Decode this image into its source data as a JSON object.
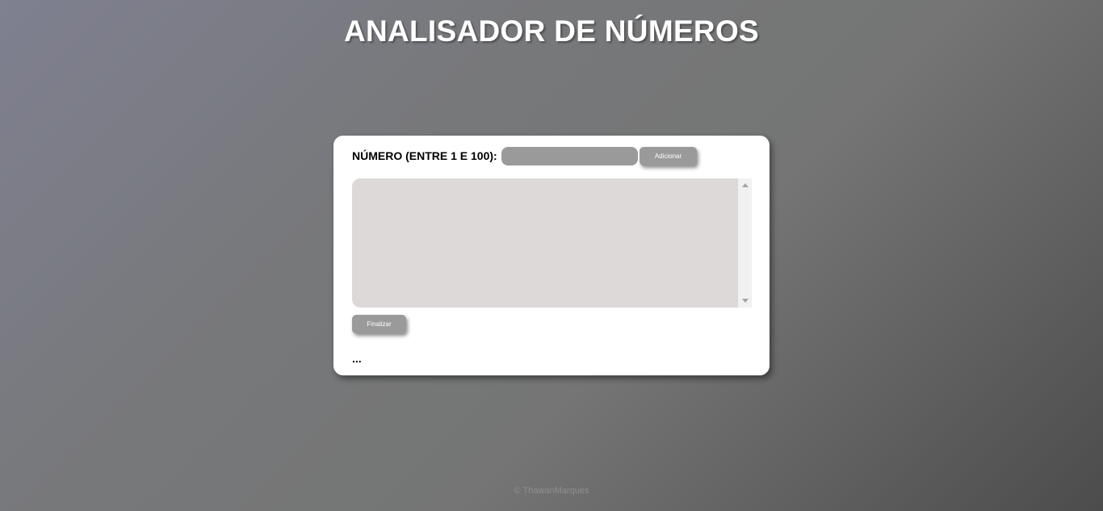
{
  "header": {
    "title": "ANALISADOR DE NÚMEROS"
  },
  "form": {
    "number_label": "NÚMERO (ENTRE 1 E 100):",
    "number_value": "",
    "number_placeholder": "",
    "add_label": "Adicionar",
    "finish_label": "Finalizar"
  },
  "list": {
    "items": []
  },
  "result": {
    "text": "..."
  },
  "footer": {
    "text": "© ThawanMarques"
  },
  "colors": {
    "card": "#ffffff",
    "button": "#9a9a9a",
    "list_bg": "#ded9d9"
  }
}
